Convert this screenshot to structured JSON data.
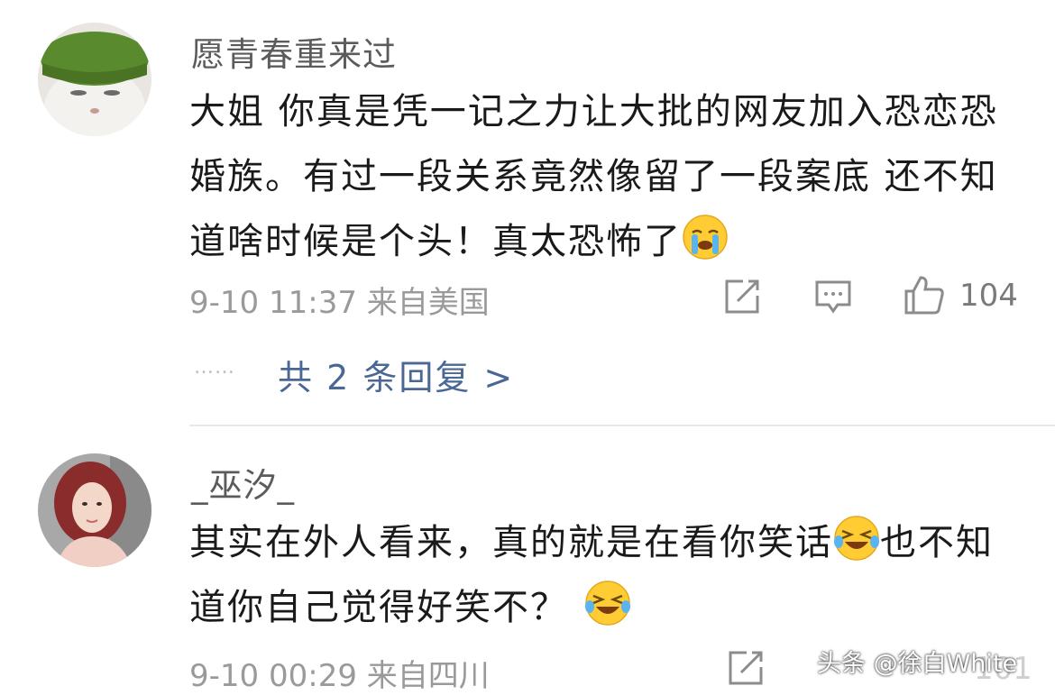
{
  "comments": [
    {
      "username": "愿青春重来过",
      "text": "大姐 你真是凭一记之力让大批的网友加入恐恋恐婚族。有过一段关系竟然像留了一段案底 还不知道啥时候是个头！真太恐怖了",
      "emoji": "crying-face-emoji",
      "meta": "9-10 11:37 来自美国",
      "likes": "104",
      "icons": [
        "share-icon",
        "comment-icon",
        "thumbs-up-icon"
      ]
    },
    {
      "username": "_巫汐_",
      "text_part1": "其实在外人看来，真的就是在看你笑话",
      "text_part2": "也不知道你自己觉得好笑不？",
      "emoji": "laughing-tears-emoji",
      "meta": "9-10 00:29 来自四川",
      "likes": "101",
      "icons": [
        "share-icon",
        "comment-icon",
        "thumbs-up-icon"
      ]
    }
  ],
  "replies": {
    "dots": "……",
    "label": "共 2 条回复 >"
  },
  "watermark": "头条 @徐白White",
  "colors": {
    "link": "#4a6795",
    "meta": "#9a9a9a",
    "text": "#1a1a1a"
  }
}
